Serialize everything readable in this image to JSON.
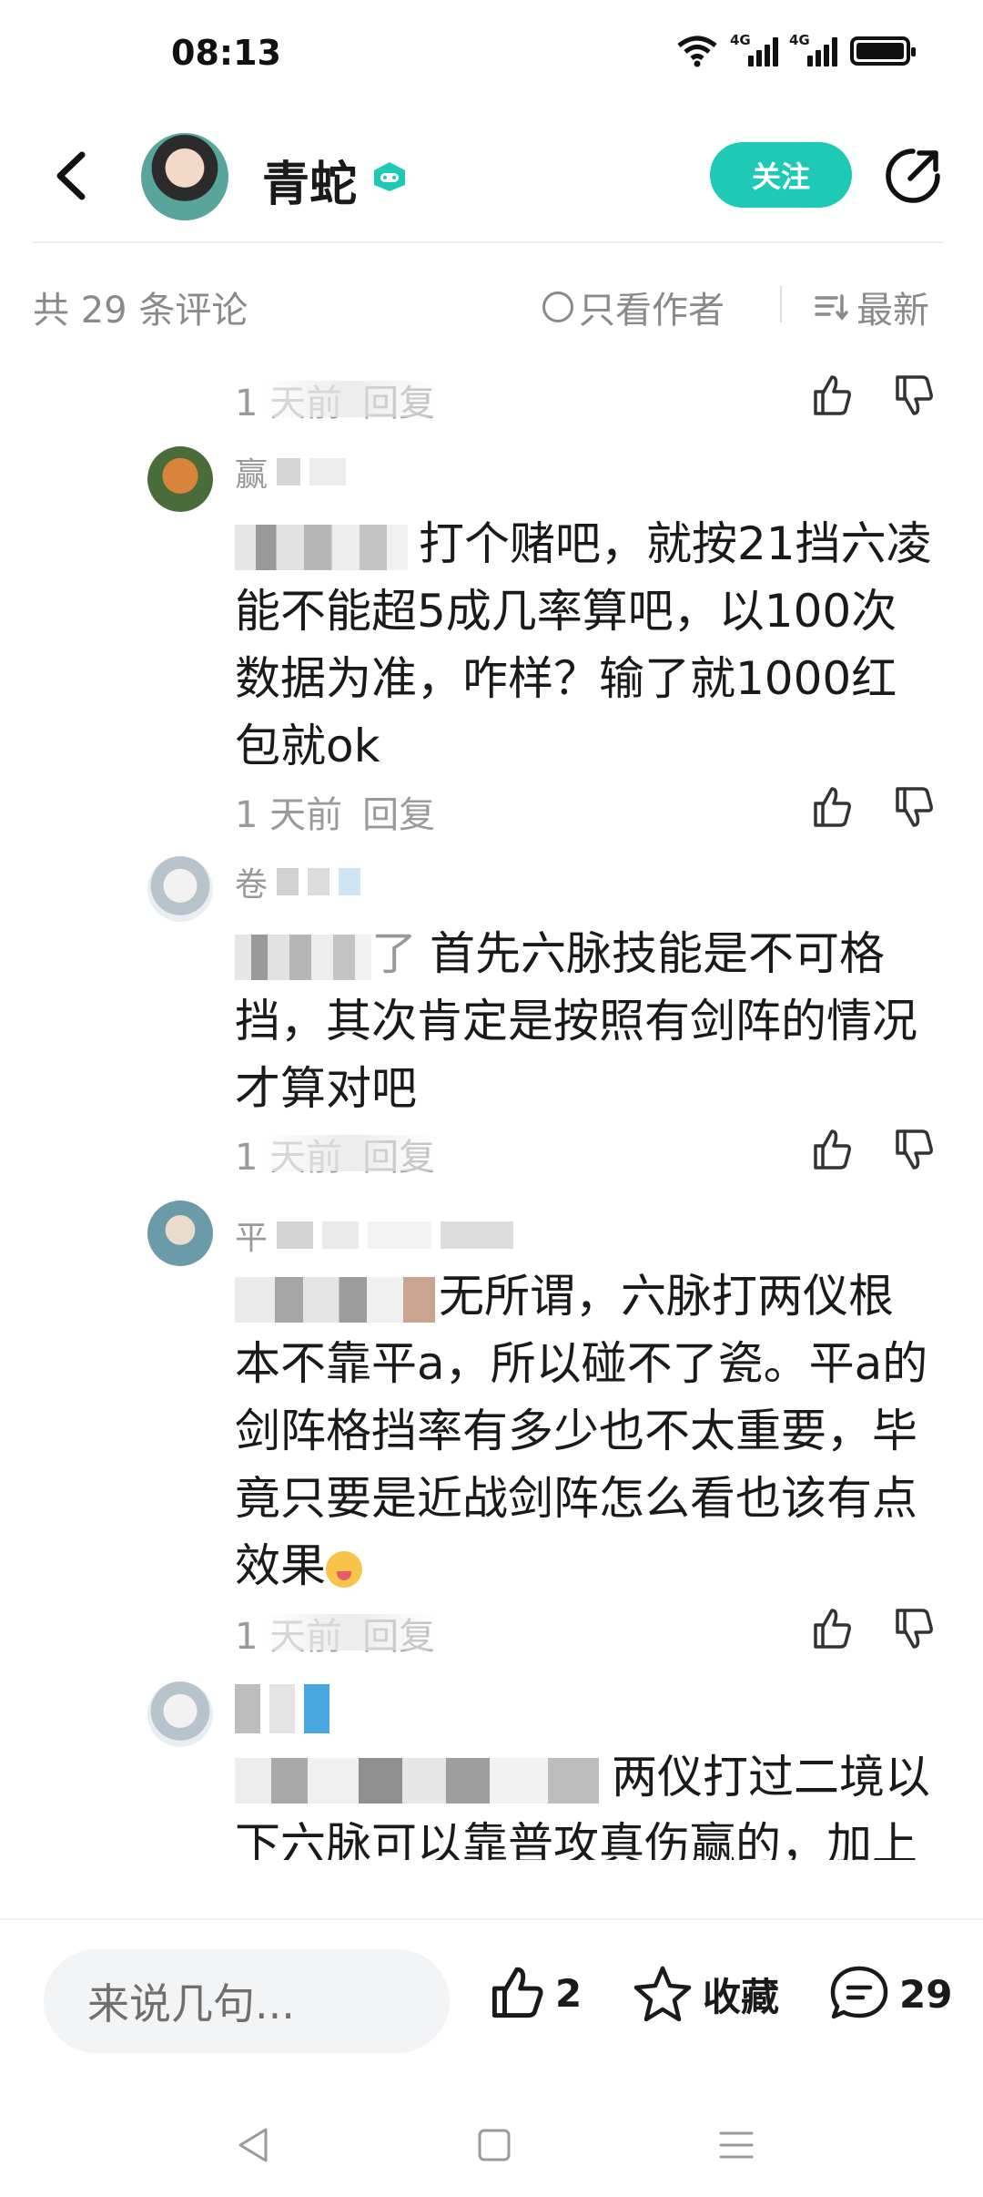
{
  "status_bar": {
    "time": "08:13",
    "network_1": "4G",
    "network_2": "4G"
  },
  "header": {
    "author_name": "青蛇",
    "follow_label": "关注"
  },
  "comment_bar": {
    "count_label": "共 29 条评论",
    "author_only_label": "只看作者",
    "sort_label": "最新"
  },
  "comments": [
    {
      "name_visible": "",
      "text": "",
      "time": "1 天前",
      "reply_label": "回复"
    },
    {
      "name_visible": "赢",
      "text": "打个赌吧，就按21挡六凌能不能超5成几率算吧，以100次数据为准，咋样？输了就1000红包就ok",
      "time": "1 天前",
      "reply_label": "回复"
    },
    {
      "name_visible": "卷",
      "mention_tail": "了",
      "text": "首先六脉技能是不可格挡，其次肯定是按照有剑阵的情况才算对吧",
      "time": "1 天前",
      "reply_label": "回复"
    },
    {
      "name_visible": "平",
      "text": "无所谓，六脉打两仪根本不靠平a，所以碰不了瓷。平a的剑阵格挡率有多少也不太重要，毕竟只要是近战剑阵怎么看也该有点效果",
      "time": "1 天前",
      "reply_label": "回复"
    },
    {
      "name_visible": "",
      "text": "两仪打过二境以下六脉可以靠普攻真伤赢的，加上剑阵挡挡六脉的普攻"
    }
  ],
  "bottom_bar": {
    "input_placeholder": "来说几句...",
    "like_count": "2",
    "collect_label": "收藏",
    "comment_count": "29"
  },
  "colors": {
    "accent": "#1ec9b5",
    "muted": "#8a8a8a",
    "text": "#1a1a1a"
  },
  "icons": [
    "back-arrow-icon",
    "game-badge-icon",
    "share-icon",
    "circle-icon",
    "sort-icon",
    "thumb-up-icon",
    "thumb-down-icon",
    "star-icon",
    "comment-bubble-icon",
    "nav-back-icon",
    "nav-home-icon",
    "nav-menu-icon"
  ]
}
